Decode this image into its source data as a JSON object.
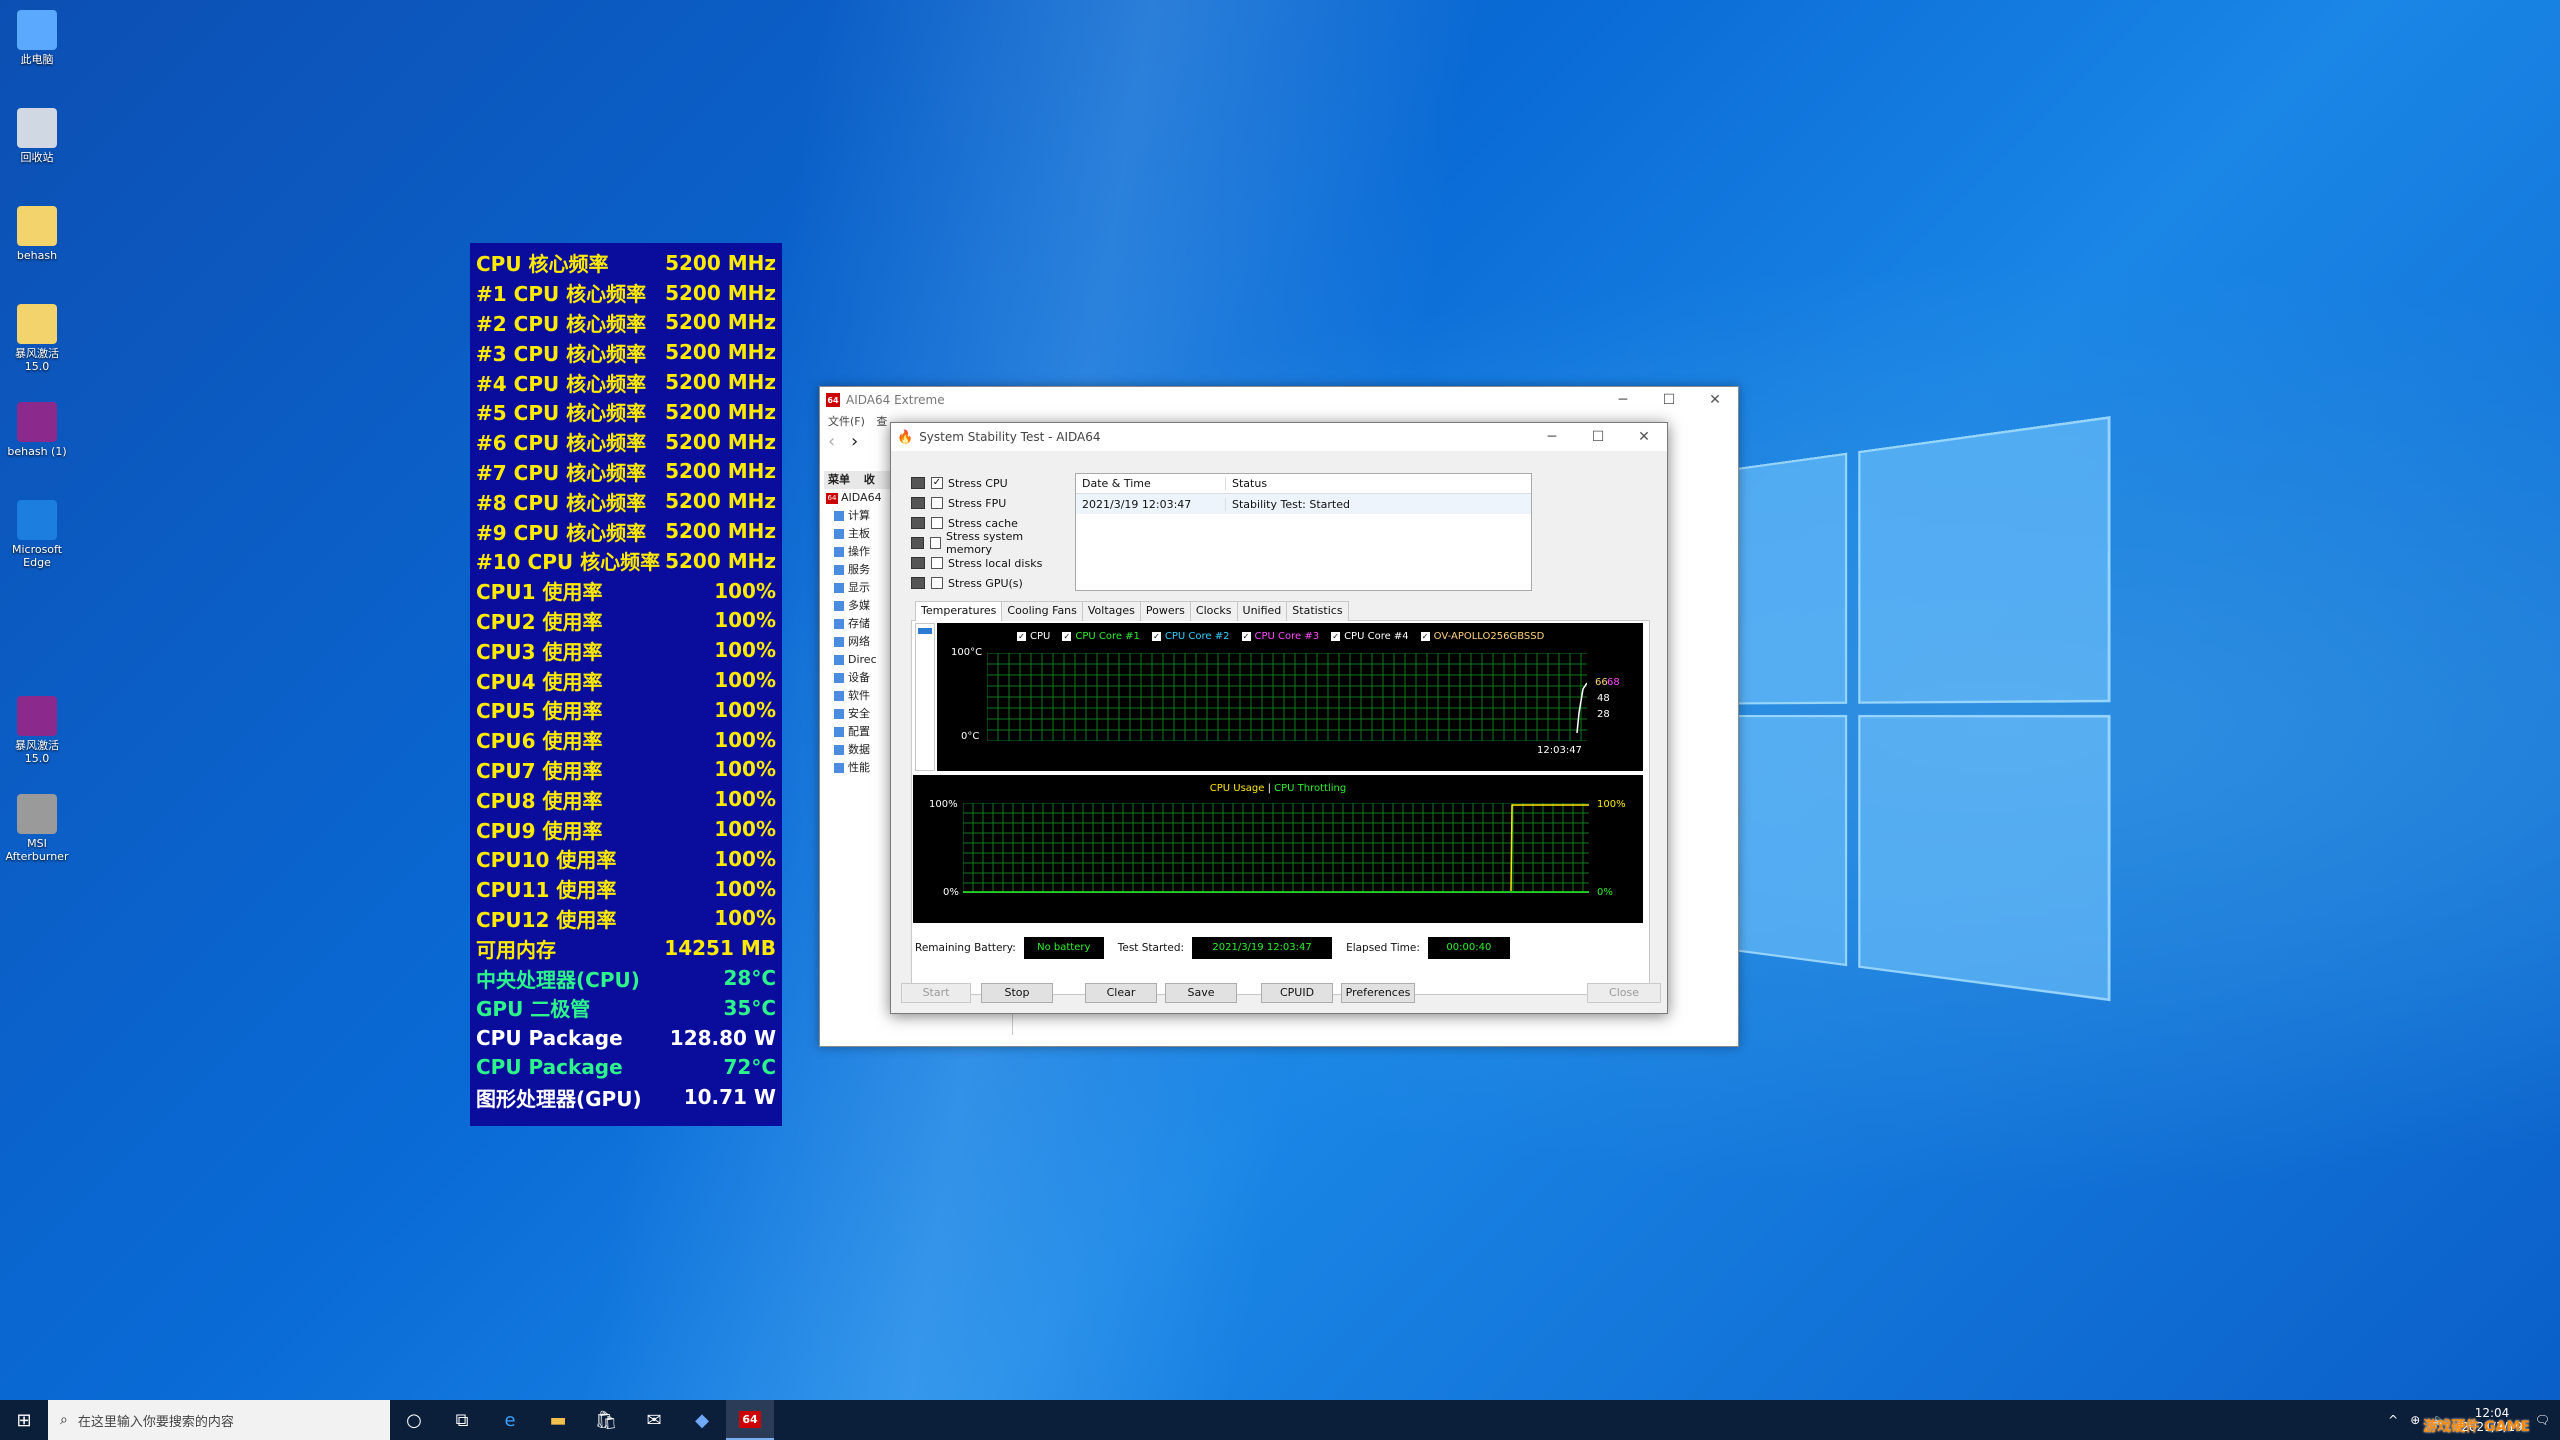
{
  "desktop": {
    "icons": [
      {
        "label": "此电脑",
        "icon": "computer-icon",
        "color": "#5aa9ff"
      },
      {
        "label": "回收站",
        "icon": "recycle-bin-icon",
        "color": "#cfd8e3"
      },
      {
        "label": "behash",
        "icon": "folder-icon",
        "color": "#f3d36b"
      },
      {
        "label": "暴风激活 15.0",
        "icon": "folder-icon",
        "color": "#f3d36b"
      },
      {
        "label": "behash (1)",
        "icon": "winrar-icon",
        "color": "#8b2a8c"
      },
      {
        "label": "Microsoft Edge",
        "icon": "edge-icon",
        "color": "#1c7fe0"
      },
      {
        "label": "暴风激活 15.0",
        "icon": "winrar-icon",
        "color": "#8b2a8c"
      },
      {
        "label": "MSI Afterburner",
        "icon": "afterburner-icon",
        "color": "#9a9a9a"
      }
    ]
  },
  "osd": {
    "rows": [
      {
        "label": "CPU 核心频率",
        "value": "5200 MHz",
        "color": "yellow"
      },
      {
        "label": "#1 CPU 核心频率",
        "value": "5200 MHz",
        "color": "yellow"
      },
      {
        "label": "#2 CPU 核心频率",
        "value": "5200 MHz",
        "color": "yellow"
      },
      {
        "label": "#3 CPU 核心频率",
        "value": "5200 MHz",
        "color": "yellow"
      },
      {
        "label": "#4 CPU 核心频率",
        "value": "5200 MHz",
        "color": "yellow"
      },
      {
        "label": "#5 CPU 核心频率",
        "value": "5200 MHz",
        "color": "yellow"
      },
      {
        "label": "#6 CPU 核心频率",
        "value": "5200 MHz",
        "color": "yellow"
      },
      {
        "label": "#7 CPU 核心频率",
        "value": "5200 MHz",
        "color": "yellow"
      },
      {
        "label": "#8 CPU 核心频率",
        "value": "5200 MHz",
        "color": "yellow"
      },
      {
        "label": "#9 CPU 核心频率",
        "value": "5200 MHz",
        "color": "yellow"
      },
      {
        "label": "#10 CPU 核心频率",
        "value": "5200 MHz",
        "color": "yellow"
      },
      {
        "label": "CPU1 使用率",
        "value": "100%",
        "color": "yellow"
      },
      {
        "label": "CPU2 使用率",
        "value": "100%",
        "color": "yellow"
      },
      {
        "label": "CPU3 使用率",
        "value": "100%",
        "color": "yellow"
      },
      {
        "label": "CPU4 使用率",
        "value": "100%",
        "color": "yellow"
      },
      {
        "label": "CPU5 使用率",
        "value": "100%",
        "color": "yellow"
      },
      {
        "label": "CPU6 使用率",
        "value": "100%",
        "color": "yellow"
      },
      {
        "label": "CPU7 使用率",
        "value": "100%",
        "color": "yellow"
      },
      {
        "label": "CPU8 使用率",
        "value": "100%",
        "color": "yellow"
      },
      {
        "label": "CPU9 使用率",
        "value": "100%",
        "color": "yellow"
      },
      {
        "label": "CPU10 使用率",
        "value": "100%",
        "color": "yellow"
      },
      {
        "label": "CPU11 使用率",
        "value": "100%",
        "color": "yellow"
      },
      {
        "label": "CPU12 使用率",
        "value": "100%",
        "color": "yellow"
      },
      {
        "label": "可用内存",
        "value": "14251 MB",
        "color": "yellow"
      },
      {
        "label": "中央处理器(CPU)",
        "value": "28°C",
        "color": "green"
      },
      {
        "label": "GPU 二极管",
        "value": "35°C",
        "color": "green"
      },
      {
        "label": "CPU Package",
        "value": "128.80 W",
        "color": "white"
      },
      {
        "label": "CPU Package",
        "value": "72°C",
        "color": "green"
      },
      {
        "label": "图形处理器(GPU)",
        "value": "10.71 W",
        "color": "white"
      }
    ]
  },
  "aida": {
    "title": "AIDA64 Extreme",
    "logo": "64",
    "menu": "文件(F)",
    "menu2": "查",
    "tree_header": "菜单",
    "tree_header2": "收",
    "tree_root": "AIDA64",
    "tree_items": [
      "计算",
      "主板",
      "操作",
      "服务",
      "显示",
      "多媒",
      "存储",
      "网络",
      "Direc",
      "设备",
      "软件",
      "安全",
      "配置",
      "数据",
      "性能"
    ]
  },
  "sst": {
    "title": "System Stability Test - AIDA64",
    "stress": [
      {
        "label": "Stress CPU",
        "checked": true
      },
      {
        "label": "Stress FPU",
        "checked": false
      },
      {
        "label": "Stress cache",
        "checked": false
      },
      {
        "label": "Stress system memory",
        "checked": false
      },
      {
        "label": "Stress local disks",
        "checked": false
      },
      {
        "label": "Stress GPU(s)",
        "checked": false
      }
    ],
    "table": {
      "col1": "Date & Time",
      "col2": "Status",
      "row_time": "2021/3/19 12:03:47",
      "row_status": "Stability Test: Started"
    },
    "tabs": [
      "Temperatures",
      "Cooling Fans",
      "Voltages",
      "Powers",
      "Clocks",
      "Unified",
      "Statistics"
    ],
    "temp_graph": {
      "legend": [
        {
          "label": "CPU",
          "color": "#ffffff"
        },
        {
          "label": "CPU Core #1",
          "color": "#2df02d"
        },
        {
          "label": "CPU Core #2",
          "color": "#35d0ff"
        },
        {
          "label": "CPU Core #3",
          "color": "#ff4cff"
        },
        {
          "label": "CPU Core #4",
          "color": "#ffffff"
        },
        {
          "label": "OV-APOLLO256GBSSD",
          "color": "#ffd37a"
        }
      ],
      "ymax": "100°C",
      "ymin": "0°C",
      "time": "12:03:47",
      "readings": [
        "66",
        "68",
        "48",
        "28"
      ]
    },
    "usage_graph": {
      "title1": "CPU Usage",
      "sep": "|",
      "title2": "CPU Throttling",
      "ymax": "100%",
      "ymin": "0%",
      "rmax": "100%",
      "rmin": "0%"
    },
    "info": {
      "battery_label": "Remaining Battery:",
      "battery_value": "No battery",
      "started_label": "Test Started:",
      "started_value": "2021/3/19 12:03:47",
      "elapsed_label": "Elapsed Time:",
      "elapsed_value": "00:00:40"
    },
    "buttons": {
      "start": "Start",
      "stop": "Stop",
      "clear": "Clear",
      "save": "Save",
      "cpuid": "CPUID",
      "preferences": "Preferences",
      "close": "Close"
    }
  },
  "taskbar": {
    "search_placeholder": "在这里输入你要搜索的内容",
    "clock_time": "12:04",
    "clock_date": "2021/3/19",
    "watermark": "游戏硬件 GAME"
  }
}
